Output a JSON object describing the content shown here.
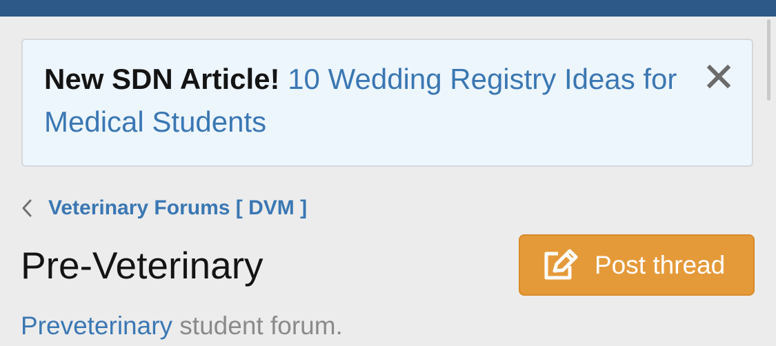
{
  "notice": {
    "label": "New SDN Article!",
    "link_text": "10 Wedding Registry Ideas for Medical Students",
    "close_icon": "close-icon"
  },
  "breadcrumb": {
    "icon": "chevron-left-icon",
    "label": "Veterinary Forums [ DVM ]"
  },
  "page": {
    "title": "Pre-Veterinary",
    "description_link": "Preveterinary",
    "description_rest": " student forum."
  },
  "post_thread": {
    "label": "Post thread",
    "icon": "edit-icon"
  },
  "colors": {
    "header": "#2c5987",
    "background": "#ececec",
    "notice_background": "#edf5fd",
    "link": "#3a77b3",
    "button": "#e59a3a"
  }
}
